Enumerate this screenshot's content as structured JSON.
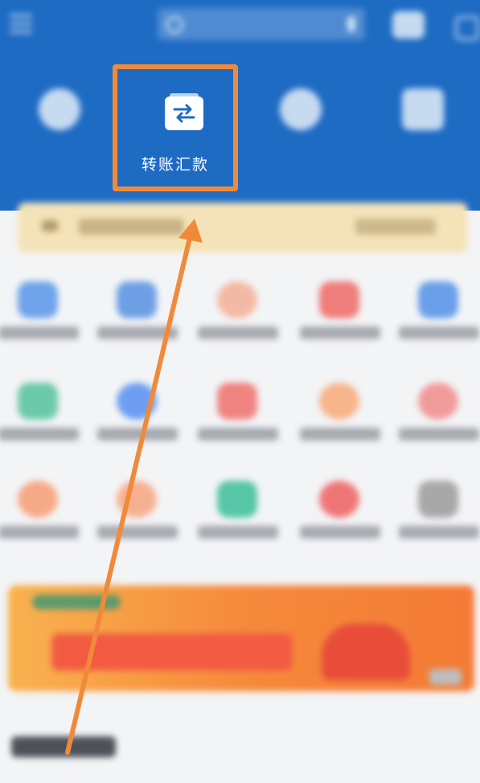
{
  "highlight": {
    "label": "转账汇款"
  },
  "colors": {
    "header_blue": "#1e6bc4",
    "highlight_orange": "#f08a3a"
  }
}
